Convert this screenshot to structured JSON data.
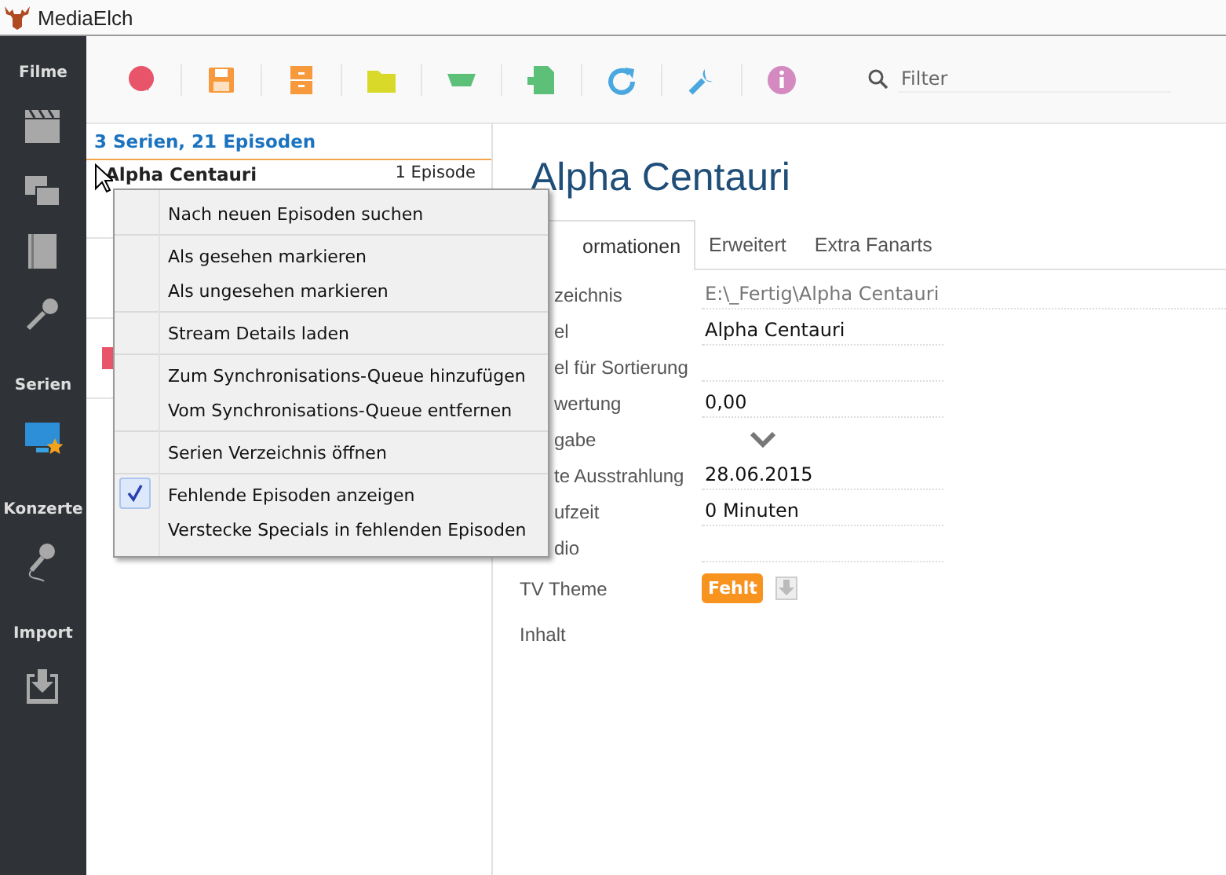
{
  "window": {
    "title": "MediaElch"
  },
  "sidebar": {
    "sections": [
      {
        "title": "Filme",
        "items": [
          {
            "selected": false
          },
          {
            "selected": false
          },
          {
            "selected": false
          },
          {
            "selected": false
          }
        ]
      },
      {
        "title": "Serien",
        "items": [
          {
            "selected": true
          }
        ]
      },
      {
        "title": "Konzerte",
        "items": [
          {
            "selected": false
          }
        ]
      },
      {
        "title": "Import",
        "items": [
          {
            "selected": false
          }
        ]
      }
    ]
  },
  "toolbar": {
    "filter": {
      "placeholder": "Filter"
    }
  },
  "list": {
    "header": "3 Serien, 21 Episoden",
    "rows": [
      {
        "title": "Alpha Centauri",
        "count": "1 Episode"
      }
    ]
  },
  "details": {
    "title": "Alpha Centauri",
    "tabs": [
      {
        "label": "ormationen",
        "selected": true,
        "covered": true
      },
      {
        "label": "Erweitert",
        "selected": false,
        "covered": false
      },
      {
        "label": "Extra Fanarts",
        "selected": false,
        "covered": false
      }
    ],
    "fields": [
      {
        "label": "zeichnis",
        "covered": true,
        "kind": "text",
        "value": "E:\\_Fertig\\Alpha Centauri",
        "disabled": true
      },
      {
        "label": "el",
        "covered": true,
        "kind": "text",
        "value": "Alpha Centauri"
      },
      {
        "label": "el für Sortierung",
        "covered": true,
        "kind": "text"
      },
      {
        "label": "wertung",
        "covered": true,
        "kind": "text",
        "value": "0,00"
      },
      {
        "label": "gabe",
        "covered": true,
        "kind": "select"
      },
      {
        "label": "te Ausstrahlung",
        "covered": true,
        "kind": "text",
        "value": "28.06.2015"
      },
      {
        "label": "ufzeit",
        "covered": true,
        "kind": "text",
        "value": "0 Minuten"
      },
      {
        "label": "dio",
        "covered": true,
        "kind": "text"
      },
      {
        "label": "TV Theme",
        "covered": false,
        "kind": "badge",
        "value": "Fehlt"
      },
      {
        "label": "Inhalt",
        "covered": false,
        "kind": "none"
      }
    ]
  },
  "context_menu": {
    "groups": [
      [
        {
          "label": "Nach neuen Episoden suchen",
          "checked": false
        }
      ],
      [
        {
          "label": "Als gesehen markieren",
          "checked": false
        },
        {
          "label": "Als ungesehen markieren",
          "checked": false
        }
      ],
      [
        {
          "label": "Stream Details laden",
          "checked": false
        }
      ],
      [
        {
          "label": "Zum Synchronisations-Queue hinzufügen",
          "checked": false
        },
        {
          "label": "Vom Synchronisations-Queue entfernen",
          "checked": false
        }
      ],
      [
        {
          "label": "Serien Verzeichnis öffnen",
          "checked": false
        }
      ],
      [
        {
          "label": "Fehlende Episoden anzeigen",
          "checked": true
        },
        {
          "label": "Verstecke Specials in fehlenden Episoden",
          "checked": false
        }
      ]
    ]
  }
}
